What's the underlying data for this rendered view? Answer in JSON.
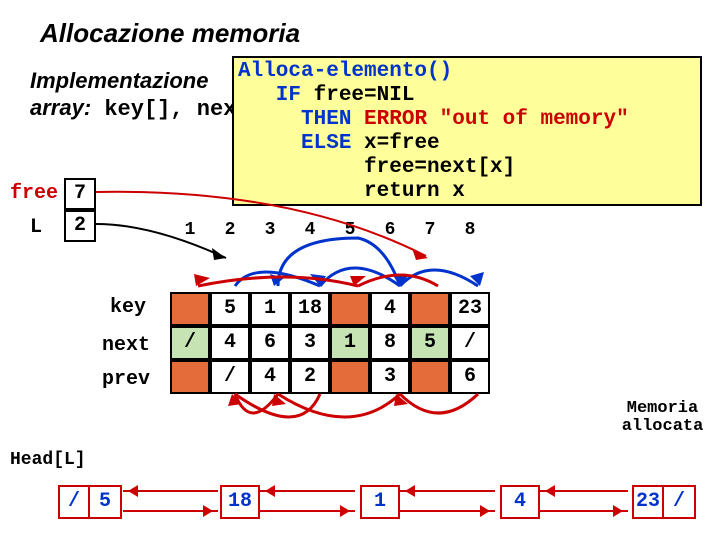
{
  "title": "Allocazione memoria",
  "subtitle_line1_a": "Implementazione",
  "subtitle_line2_a": "array:",
  "subtitle_line2_b_k": " key[], ",
  "subtitle_line2_c": "next",
  "code": {
    "l1": "Alloca-elemento()",
    "l2a": "   IF ",
    "l2b": "free=NIL",
    "l3a": "     THEN ",
    "l3b": "ERROR ",
    "l3c": "\"out of memory\"",
    "l4a": "     ELSE ",
    "l4b": "x=free",
    "l5": "          free=next[x]",
    "l6": "          return x"
  },
  "vars": {
    "free_lbl": "free",
    "free_val": "7",
    "L_lbl": "L",
    "L_val": "2"
  },
  "indices": [
    "1",
    "2",
    "3",
    "4",
    "5",
    "6",
    "7",
    "8"
  ],
  "rowlabels": {
    "key": "key",
    "next": "next",
    "prev": "prev"
  },
  "key": [
    "",
    "5",
    "1",
    "18",
    "",
    "4",
    "",
    "23"
  ],
  "next": [
    "/",
    "4",
    "6",
    "3",
    "1",
    "8",
    "5",
    "/"
  ],
  "prev": [
    "",
    "/",
    "4",
    "2",
    "",
    "3",
    "",
    "6"
  ],
  "redcols": [
    true,
    false,
    false,
    false,
    true,
    false,
    true,
    false
  ],
  "head_lbl": "Head[L]",
  "mem_lbl_1": "Memoria",
  "mem_lbl_2": "allocata",
  "list": {
    "node1": [
      "/",
      "5"
    ],
    "node2": "18",
    "node3": "1",
    "node4": "4",
    "node5": [
      "23",
      "/"
    ]
  }
}
